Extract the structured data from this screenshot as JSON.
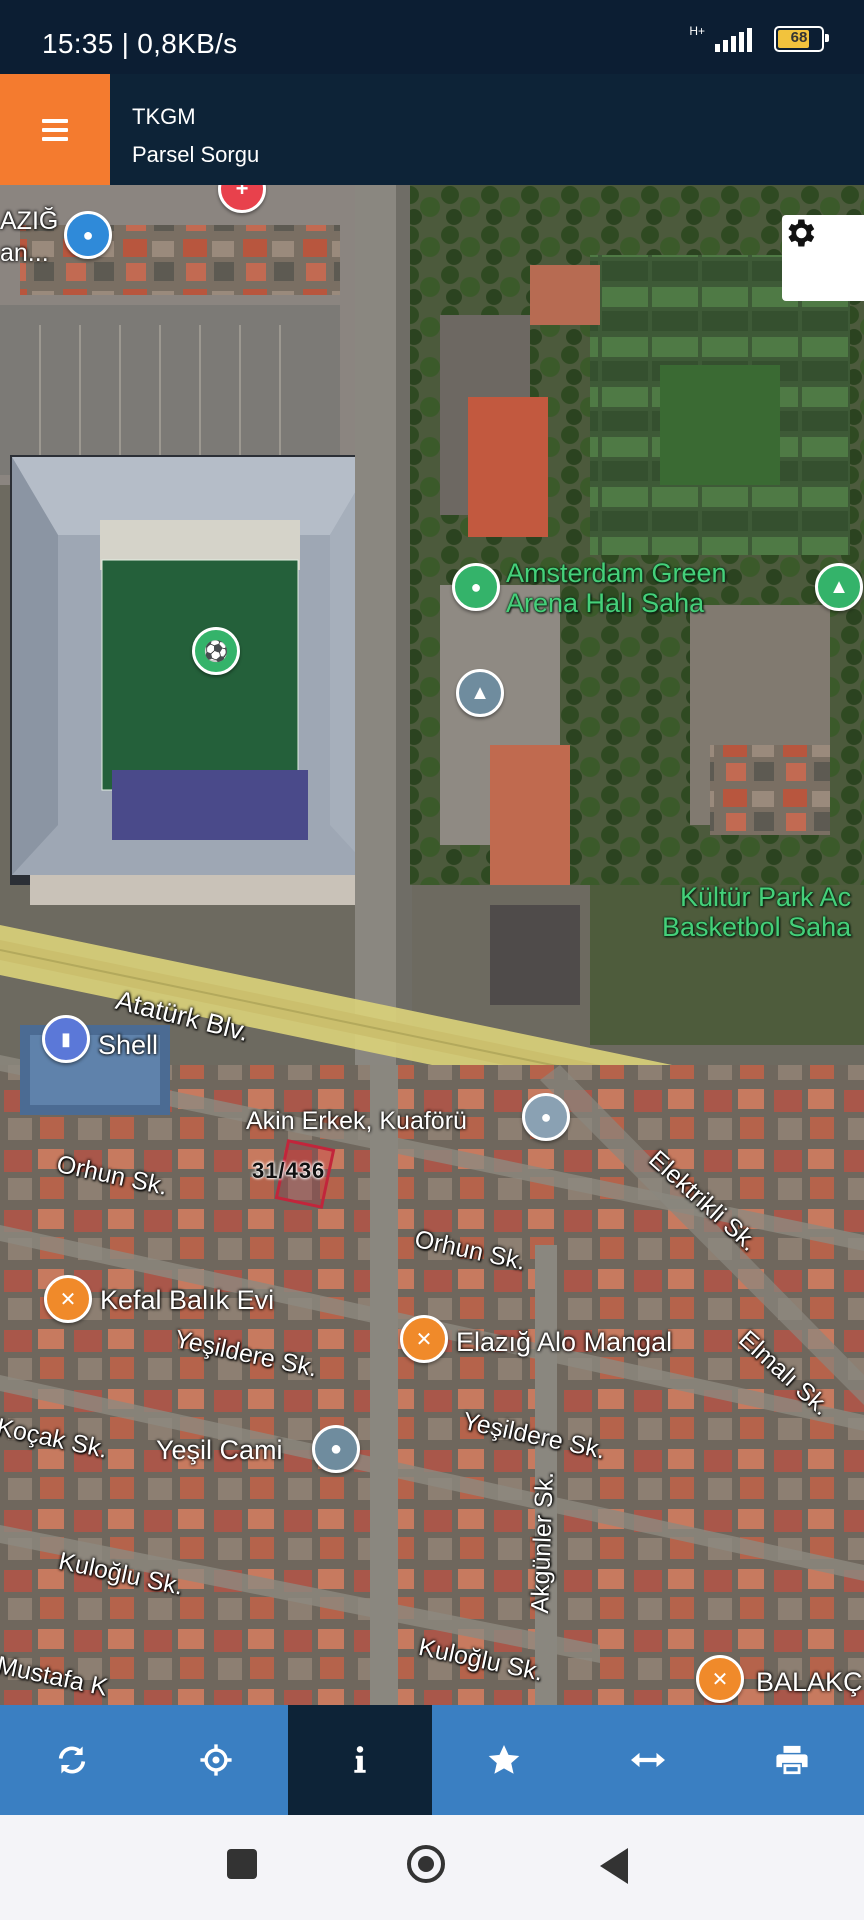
{
  "status_bar": {
    "time_speed": "15:35 | 0,8KB/s",
    "network": "H+",
    "battery": "68"
  },
  "app_bar": {
    "title": "TKGM",
    "subtitle": "Parsel Sorgu"
  },
  "map": {
    "pois": {
      "amsterdam_1": "Amsterdam Green",
      "amsterdam_2": "Arena Halı Saha",
      "kultur_1": "Kültür Park Ac",
      "kultur_2": "Basketbol Saha",
      "shell": "Shell",
      "akin": "Akin Erkek, Kuaförü",
      "kefal": "Kefal Balık Evi",
      "elazig_alo": "Elazığ Alo Mangal",
      "yesil_cami": "Yeşil Cami",
      "balak": "BALAKÇ",
      "elazig_top_1": "AZIĞ",
      "elazig_top_2": "an..."
    },
    "streets": {
      "ataturk": "Atatürk Blv.",
      "orhun1": "Orhun Sk.",
      "orhun2": "Orhun Sk.",
      "elektrikli": "Elektrikli Sk.",
      "elmali": "Elmalı Sk.",
      "yesildere1": "Yeşildere Sk.",
      "yesildere2": "Yeşildere Sk.",
      "kocak": "Koçak Sk.",
      "kuloglu1": "Kuloğlu Sk.",
      "kuloglu2": "Kuloğlu Sk.",
      "akgunler": "Akgünler Sk.",
      "mustafa": "Mustafa K"
    },
    "parcel_label": "31/436"
  },
  "toolbar": {
    "items": [
      "refresh-icon",
      "locate-icon",
      "info-icon",
      "star-icon",
      "measure-icon",
      "print-icon"
    ],
    "active": "info-icon"
  },
  "colors": {
    "accent": "#f47b2f",
    "bar": "#0d2337",
    "toolbar": "#3a7fc2"
  }
}
